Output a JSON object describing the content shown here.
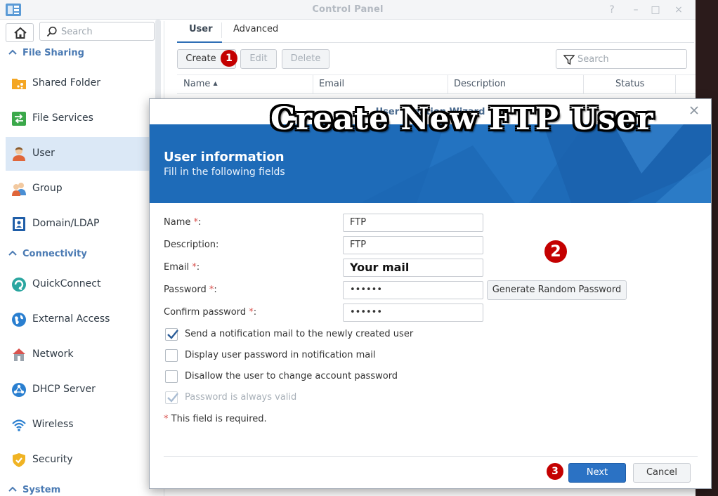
{
  "window": {
    "title": "Control Panel",
    "controls": [
      "?",
      "–",
      "□",
      "×"
    ]
  },
  "sidebar": {
    "search_placeholder": "Search",
    "categories": [
      {
        "label": "File Sharing",
        "items": [
          {
            "label": "Shared Folder",
            "icon": "shared-folder-icon"
          },
          {
            "label": "File Services",
            "icon": "file-services-icon"
          },
          {
            "label": "User",
            "icon": "user-icon",
            "active": true
          },
          {
            "label": "Group",
            "icon": "group-icon"
          },
          {
            "label": "Domain/LDAP",
            "icon": "domain-ldap-icon"
          }
        ]
      },
      {
        "label": "Connectivity",
        "items": [
          {
            "label": "QuickConnect",
            "icon": "quickconnect-icon"
          },
          {
            "label": "External Access",
            "icon": "external-access-icon"
          },
          {
            "label": "Network",
            "icon": "network-icon"
          },
          {
            "label": "DHCP Server",
            "icon": "dhcp-server-icon"
          },
          {
            "label": "Wireless",
            "icon": "wireless-icon"
          },
          {
            "label": "Security",
            "icon": "security-icon"
          }
        ]
      },
      {
        "label": "System",
        "items": []
      }
    ]
  },
  "content": {
    "tabs": [
      "User",
      "Advanced"
    ],
    "active_tab": "User",
    "toolbar": {
      "create": "Create",
      "edit": "Edit",
      "delete": "Delete"
    },
    "search_placeholder": "Search",
    "columns": [
      "Name",
      "Email",
      "Description",
      "Status"
    ],
    "sort_column": "Name"
  },
  "markers": {
    "one": "1",
    "two": "2",
    "three": "3"
  },
  "overlay_title": "Create New FTP User",
  "dialog": {
    "title": "User Creation Wizard",
    "heading": "User information",
    "subheading": "Fill in the following fields",
    "fields": {
      "name": {
        "label": "Name",
        "value": "FTP",
        "required": true
      },
      "description": {
        "label": "Description:",
        "value": "FTP"
      },
      "email": {
        "label": "Email",
        "value": "Your mail",
        "required": true
      },
      "password": {
        "label": "Password",
        "value": "••••••",
        "required": true
      },
      "confirm": {
        "label": "Confirm password",
        "value": "••••••",
        "required": true
      }
    },
    "generate_button": "Generate Random Password",
    "checkboxes": [
      {
        "label": "Send a notification mail to the newly created user",
        "checked": true,
        "disabled": false
      },
      {
        "label": "Display user password in notification mail",
        "checked": false,
        "disabled": false
      },
      {
        "label": "Disallow the user to change account password",
        "checked": false,
        "disabled": false
      },
      {
        "label": "Password is always valid",
        "checked": true,
        "disabled": true
      }
    ],
    "required_note_star": "*",
    "required_note": " This field is required.",
    "next": "Next",
    "cancel": "Cancel"
  },
  "colors": {
    "accent": "#2b72c4",
    "banner": "#1e6bb8",
    "marker": "#c40000",
    "active_item": "#dbe8f6"
  }
}
